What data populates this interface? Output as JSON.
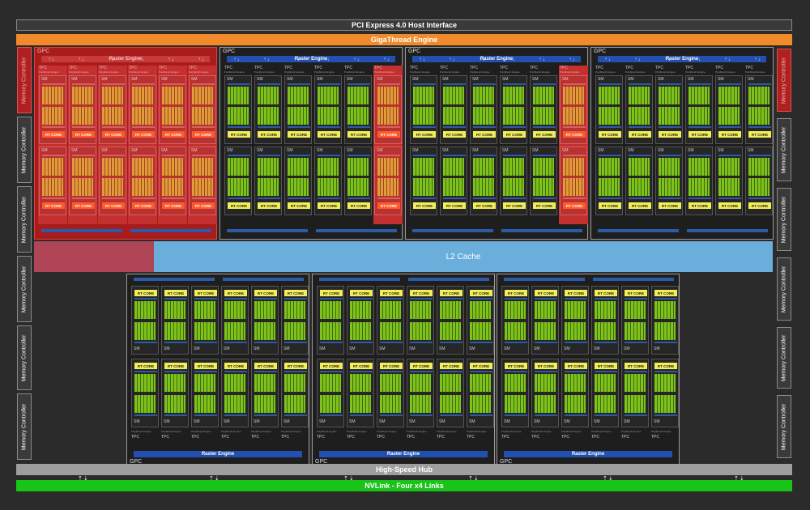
{
  "host_interface": "PCI Express 4.0 Host Interface",
  "gigathread": "GigaThread Engine",
  "l2_cache": "L2 Cache",
  "high_speed_hub": "High-Speed Hub",
  "nvlink": "NVLink - Four x4 Links",
  "memory_controller": "Memory Controller",
  "gpc_label": "GPC",
  "raster_engine": "Raster Engine",
  "tpc_label": "TPC",
  "polymorph_engine": "PolyMorph Engine",
  "sm_label": "SM",
  "rt_core": "RT CORE",
  "disabled_units": {
    "gpc_top": [
      0
    ],
    "tpc_disabled": {
      "gpc_top_1": [
        5
      ],
      "gpc_top_2": [
        5
      ]
    },
    "memory_controller_left": [
      0
    ],
    "memory_controller_right": [
      0
    ],
    "l2_disabled_fraction": 0.16
  },
  "colors": {
    "background": "#2b2b2b",
    "giga_thread": "#f08a2a",
    "nvlink": "#18c418",
    "l2": "#6aaedb",
    "raster": "#2150b0",
    "cuda_core": "#7fc21c",
    "rt_core": "#f2ee5a",
    "disabled": "#a81c1c"
  }
}
